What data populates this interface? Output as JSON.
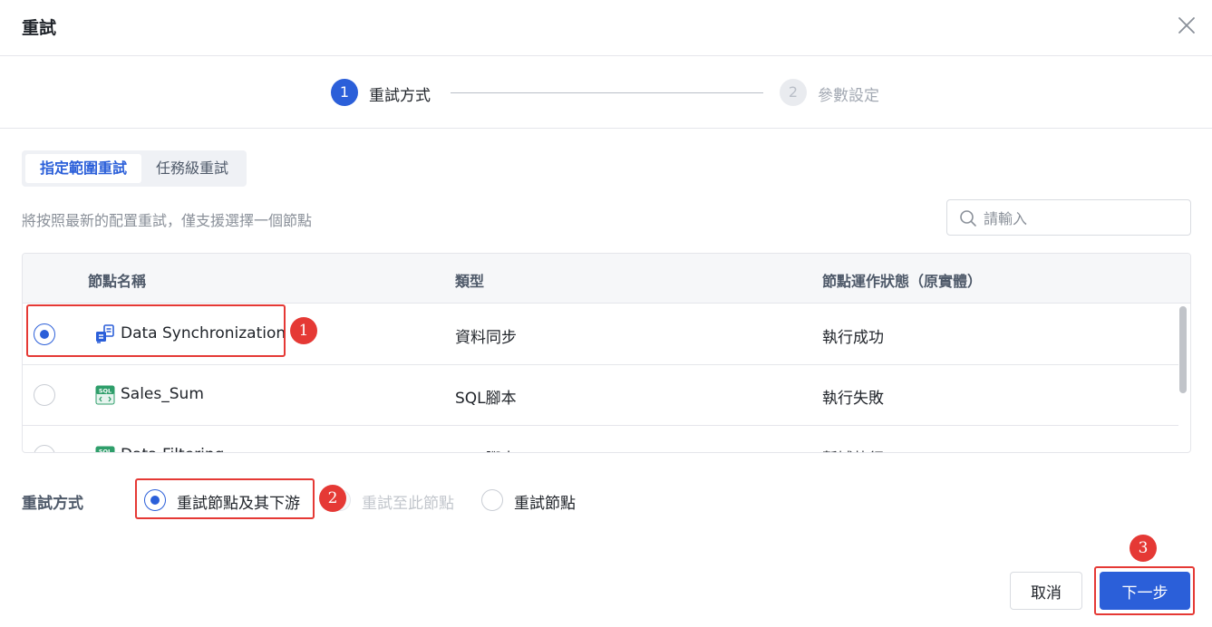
{
  "dialog": {
    "title": "重試"
  },
  "steps": [
    {
      "number": "1",
      "label": "重試方式"
    },
    {
      "number": "2",
      "label": "參數設定"
    }
  ],
  "tabs": [
    {
      "label": "指定範圍重試"
    },
    {
      "label": "任務級重試"
    }
  ],
  "hint": "將按照最新的配置重試，僅支援選擇一個節點",
  "search": {
    "placeholder": "請輸入"
  },
  "table": {
    "columns": [
      "節點名稱",
      "類型",
      "節點運作狀態（原實體）"
    ],
    "rows": [
      {
        "name": "Data Synchronization",
        "type": "資料同步",
        "status": "執行成功"
      },
      {
        "name": "Sales_Sum",
        "type": "SQL腳本",
        "status": "執行失敗"
      },
      {
        "name": "Data Filtering",
        "type": "SQL腳本",
        "status": "暫域執行"
      }
    ]
  },
  "retry_mode": {
    "label": "重試方式",
    "options": [
      {
        "label": "重試節點及其下游"
      },
      {
        "label": "重試至此節點"
      },
      {
        "label": "重試節點"
      }
    ]
  },
  "footer": {
    "cancel_label": "取消",
    "next_label": "下一步"
  },
  "markers": [
    "1",
    "2",
    "3"
  ],
  "colors": {
    "primary": "#2b5fd9",
    "highlight": "#e53935"
  }
}
